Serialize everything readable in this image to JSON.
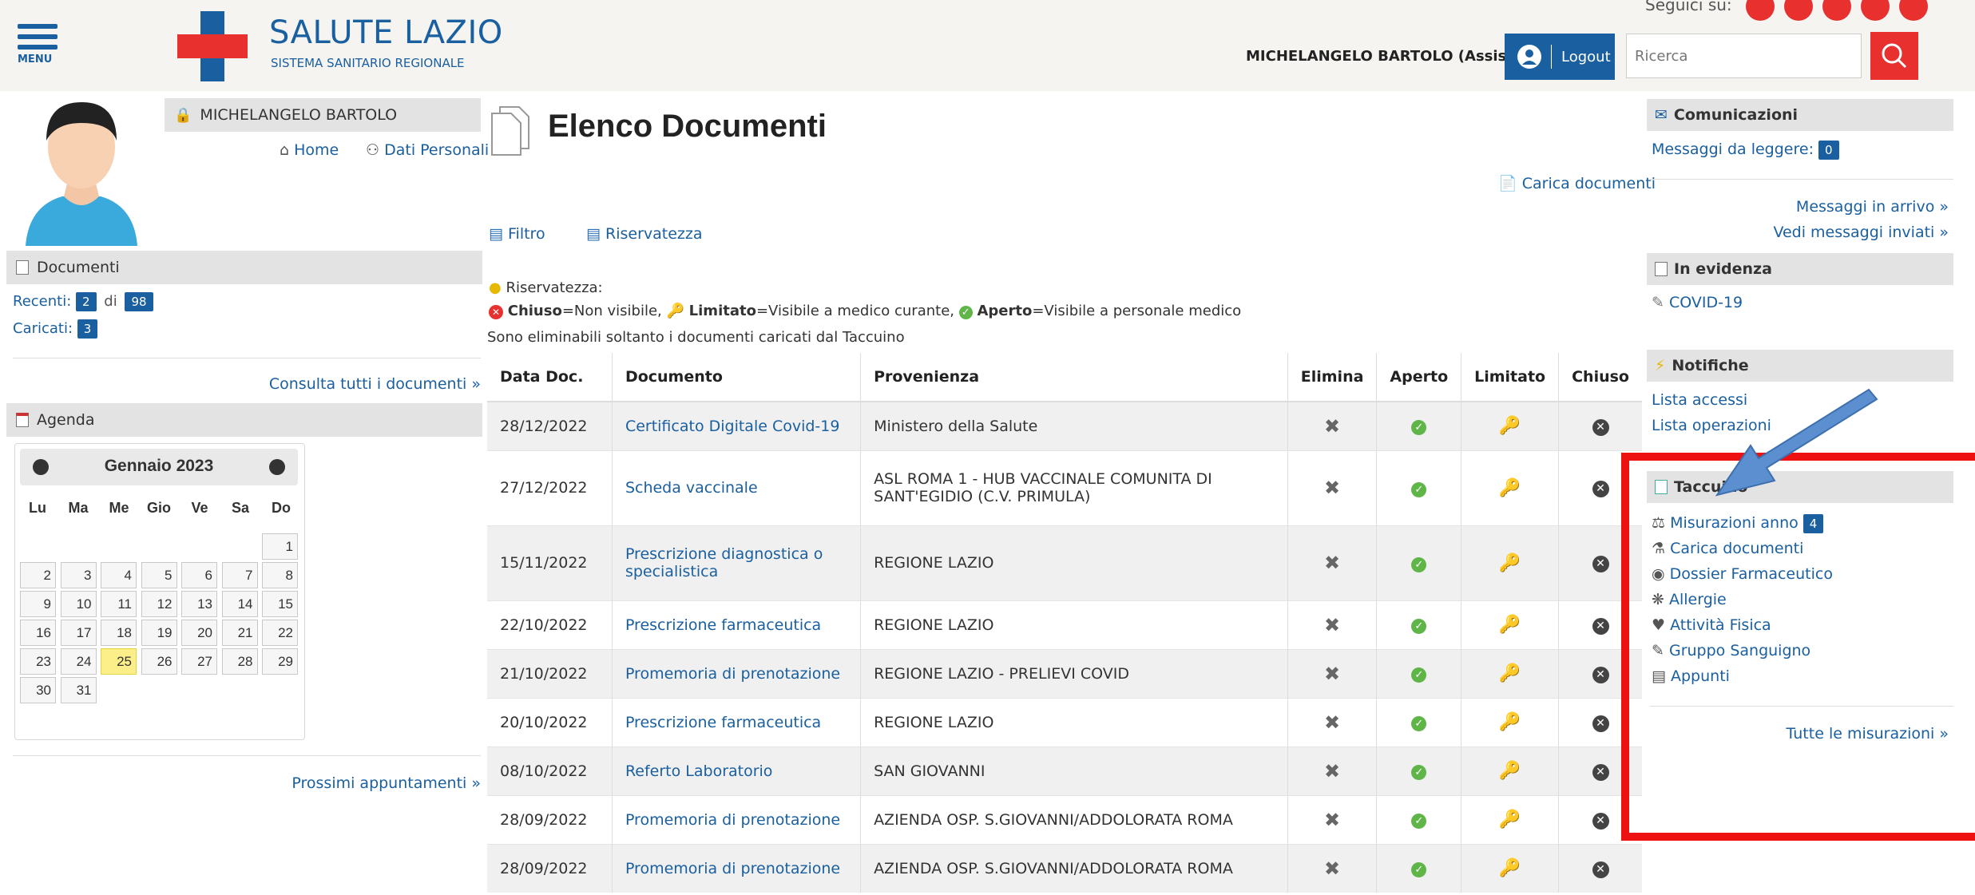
{
  "header": {
    "menu_label": "MENU",
    "logo_title": "SALUTE LAZIO",
    "logo_subtitle": "SISTEMA SANITARIO REGIONALE",
    "user_display": "MICHELANGELO BARTOLO (Assistito)",
    "logout_label": "Logout",
    "search_placeholder": "Ricerca",
    "social_label": "Seguici su:",
    "brand_blue": "#1a5fa0",
    "brand_red": "#e8302f"
  },
  "left": {
    "user_name": "MICHELANGELO BARTOLO",
    "home_link": "Home",
    "personal_link": "Dati Personali",
    "documents": {
      "title": "Documenti",
      "recent_label": "Recenti:",
      "recent_count": "2",
      "of_label": "di",
      "total_count": "98",
      "loaded_label": "Caricati:",
      "loaded_count": "3",
      "all_link": "Consulta tutti i documenti »"
    },
    "agenda": {
      "title": "Agenda",
      "month": "Gennaio 2023",
      "weekdays": [
        "Lu",
        "Ma",
        "Me",
        "Gio",
        "Ve",
        "Sa",
        "Do"
      ],
      "today": "25",
      "next_link": "Prossimi appuntamenti »"
    }
  },
  "main": {
    "title": "Elenco Documenti",
    "upload_link": "Carica documenti",
    "filter_link": "Filtro",
    "privacy_link": "Riservatezza",
    "privacy_heading": "Riservatezza:",
    "legend_closed_bold": "Chiuso",
    "legend_closed_text": "=Non visibile,",
    "legend_limited_bold": "Limitato",
    "legend_limited_text": "=Visibile a medico curante,",
    "legend_open_bold": "Aperto",
    "legend_open_text": "=Visibile a personale medico",
    "note": "Sono eliminabili soltanto i documenti caricati dal Taccuino",
    "columns": [
      "Data Doc.",
      "Documento",
      "Provenienza",
      "Elimina",
      "Aperto",
      "Limitato",
      "Chiuso"
    ],
    "rows": [
      {
        "date": "28/12/2022",
        "doc": "Certificato Digitale Covid-19",
        "source": "Ministero della Salute"
      },
      {
        "date": "27/12/2022",
        "doc": "Scheda vaccinale",
        "source": "ASL ROMA 1 - HUB VACCINALE COMUNITA DI SANT'EGIDIO (C.V. PRIMULA)"
      },
      {
        "date": "15/11/2022",
        "doc": "Prescrizione diagnostica o specialistica",
        "source": "REGIONE LAZIO"
      },
      {
        "date": "22/10/2022",
        "doc": "Prescrizione farmaceutica",
        "source": "REGIONE LAZIO"
      },
      {
        "date": "21/10/2022",
        "doc": "Promemoria di prenotazione",
        "source": "REGIONE LAZIO - PRELIEVI COVID"
      },
      {
        "date": "20/10/2022",
        "doc": "Prescrizione farmaceutica",
        "source": "REGIONE LAZIO"
      },
      {
        "date": "08/10/2022",
        "doc": "Referto Laboratorio",
        "source": "SAN GIOVANNI"
      },
      {
        "date": "28/09/2022",
        "doc": "Promemoria di prenotazione",
        "source": "AZIENDA OSP. S.GIOVANNI/ADDOLORATA ROMA"
      },
      {
        "date": "28/09/2022",
        "doc": "Promemoria di prenotazione",
        "source": "AZIENDA OSP. S.GIOVANNI/ADDOLORATA ROMA"
      }
    ]
  },
  "right": {
    "comms_title": "Comunicazioni",
    "unread_label": "Messaggi da leggere:",
    "unread_count": "0",
    "inbox_link": "Messaggi in arrivo »",
    "sent_link": "Vedi messaggi inviati »",
    "highlight_title": "In evidenza",
    "covid_link": "COVID-19",
    "notif_title": "Notifiche",
    "access_link": "Lista accessi",
    "ops_link": "Lista operazioni",
    "notebook_title": "Taccuino",
    "measures_link": "Misurazioni anno",
    "measures_count": "4",
    "upload_link": "Carica documenti",
    "pharma_link": "Dossier Farmaceutico",
    "allergy_link": "Allergie",
    "activity_link": "Attività Fisica",
    "blood_link": "Gruppo Sanguigno",
    "notes_link": "Appunti",
    "all_measures_link": "Tutte le misurazioni »",
    "highlight_color": "#ee1111",
    "arrow_color": "#5b8fd0"
  }
}
